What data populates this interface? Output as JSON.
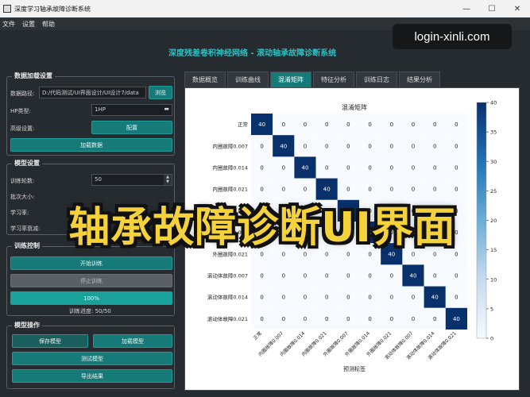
{
  "window": {
    "title": "深度学习轴承故障诊断系统",
    "minimize": "—",
    "maximize": "☐",
    "close": "✕"
  },
  "menu": [
    "文件",
    "设置",
    "帮助"
  ],
  "watermark": "login-xinli.com",
  "app_title": "深度残差卷积神经网络 - 滚动轴承故障诊断系统",
  "data_group": {
    "title": "数据加载设置",
    "path_label": "数据路径:",
    "path_value": "D:/代码测试/UI界面设计/UI设计7/data",
    "browse": "浏览",
    "hp_label": "HP类型:",
    "hp_value": "1HP",
    "advanced_label": "高级设置:",
    "config": "配置",
    "load": "加载数据"
  },
  "model_group": {
    "title": "模型设置",
    "epochs_label": "训练轮数:",
    "epochs_value": "50",
    "batch_label": "批次大小:",
    "lr_label": "学习率:",
    "lr2_label": "学习率衰减:"
  },
  "train_group": {
    "title": "训练控制",
    "start": "开始训练",
    "stop": "停止训练",
    "progress_text": "100%",
    "progress": 1.0,
    "status": "训练进度: 50/50"
  },
  "ops_group": {
    "title": "模型操作",
    "save": "保存模型",
    "load": "加载模型",
    "test": "测试模型",
    "export": "导出结果"
  },
  "tabs": [
    "数据概览",
    "训练曲线",
    "混淆矩阵",
    "特征分析",
    "训练日志",
    "结果分析"
  ],
  "active_tab": 2,
  "banner": "轴承故障诊断UI界面",
  "colors": {
    "accent": "#167a78",
    "heat_high": "#08306b",
    "heat_low": "#f7fbff"
  },
  "chart_data": {
    "type": "heatmap",
    "title": "混淆矩阵",
    "xlabel": "预测标签",
    "ylabel": "",
    "rows": [
      "正常",
      "内圈故障0.007",
      "内圈故障0.014",
      "内圈故障0.021",
      "外圈故障0.007",
      "外圈故障0.014",
      "外圈故障0.021",
      "滚动体故障0.007",
      "滚动体故障0.014",
      "滚动体故障0.021"
    ],
    "cols": [
      "正常",
      "内圈故障0.007",
      "内圈故障0.014",
      "内圈故障0.021",
      "外圈故障0.007",
      "外圈故障0.014",
      "外圈故障0.021",
      "滚动体故障0.007",
      "滚动体故障0.014",
      "滚动体故障0.021"
    ],
    "values": [
      [
        40,
        0,
        0,
        0,
        0,
        0,
        0,
        0,
        0,
        0
      ],
      [
        0,
        40,
        0,
        0,
        0,
        0,
        0,
        0,
        0,
        0
      ],
      [
        0,
        0,
        40,
        0,
        0,
        0,
        0,
        0,
        0,
        0
      ],
      [
        0,
        0,
        0,
        40,
        0,
        0,
        0,
        0,
        0,
        0
      ],
      [
        0,
        0,
        0,
        0,
        40,
        0,
        0,
        0,
        0,
        0
      ],
      [
        0,
        0,
        0,
        0,
        0,
        40,
        0,
        0,
        0,
        0
      ],
      [
        0,
        0,
        0,
        0,
        0,
        0,
        40,
        0,
        0,
        0
      ],
      [
        0,
        0,
        0,
        0,
        0,
        0,
        0,
        40,
        0,
        0
      ],
      [
        0,
        0,
        0,
        0,
        0,
        0,
        0,
        0,
        40,
        0
      ],
      [
        0,
        0,
        0,
        0,
        0,
        0,
        0,
        0,
        0,
        40
      ]
    ],
    "colorbar_ticks": [
      0,
      5,
      10,
      15,
      20,
      25,
      30,
      35,
      40
    ],
    "vmin": 0,
    "vmax": 40
  }
}
